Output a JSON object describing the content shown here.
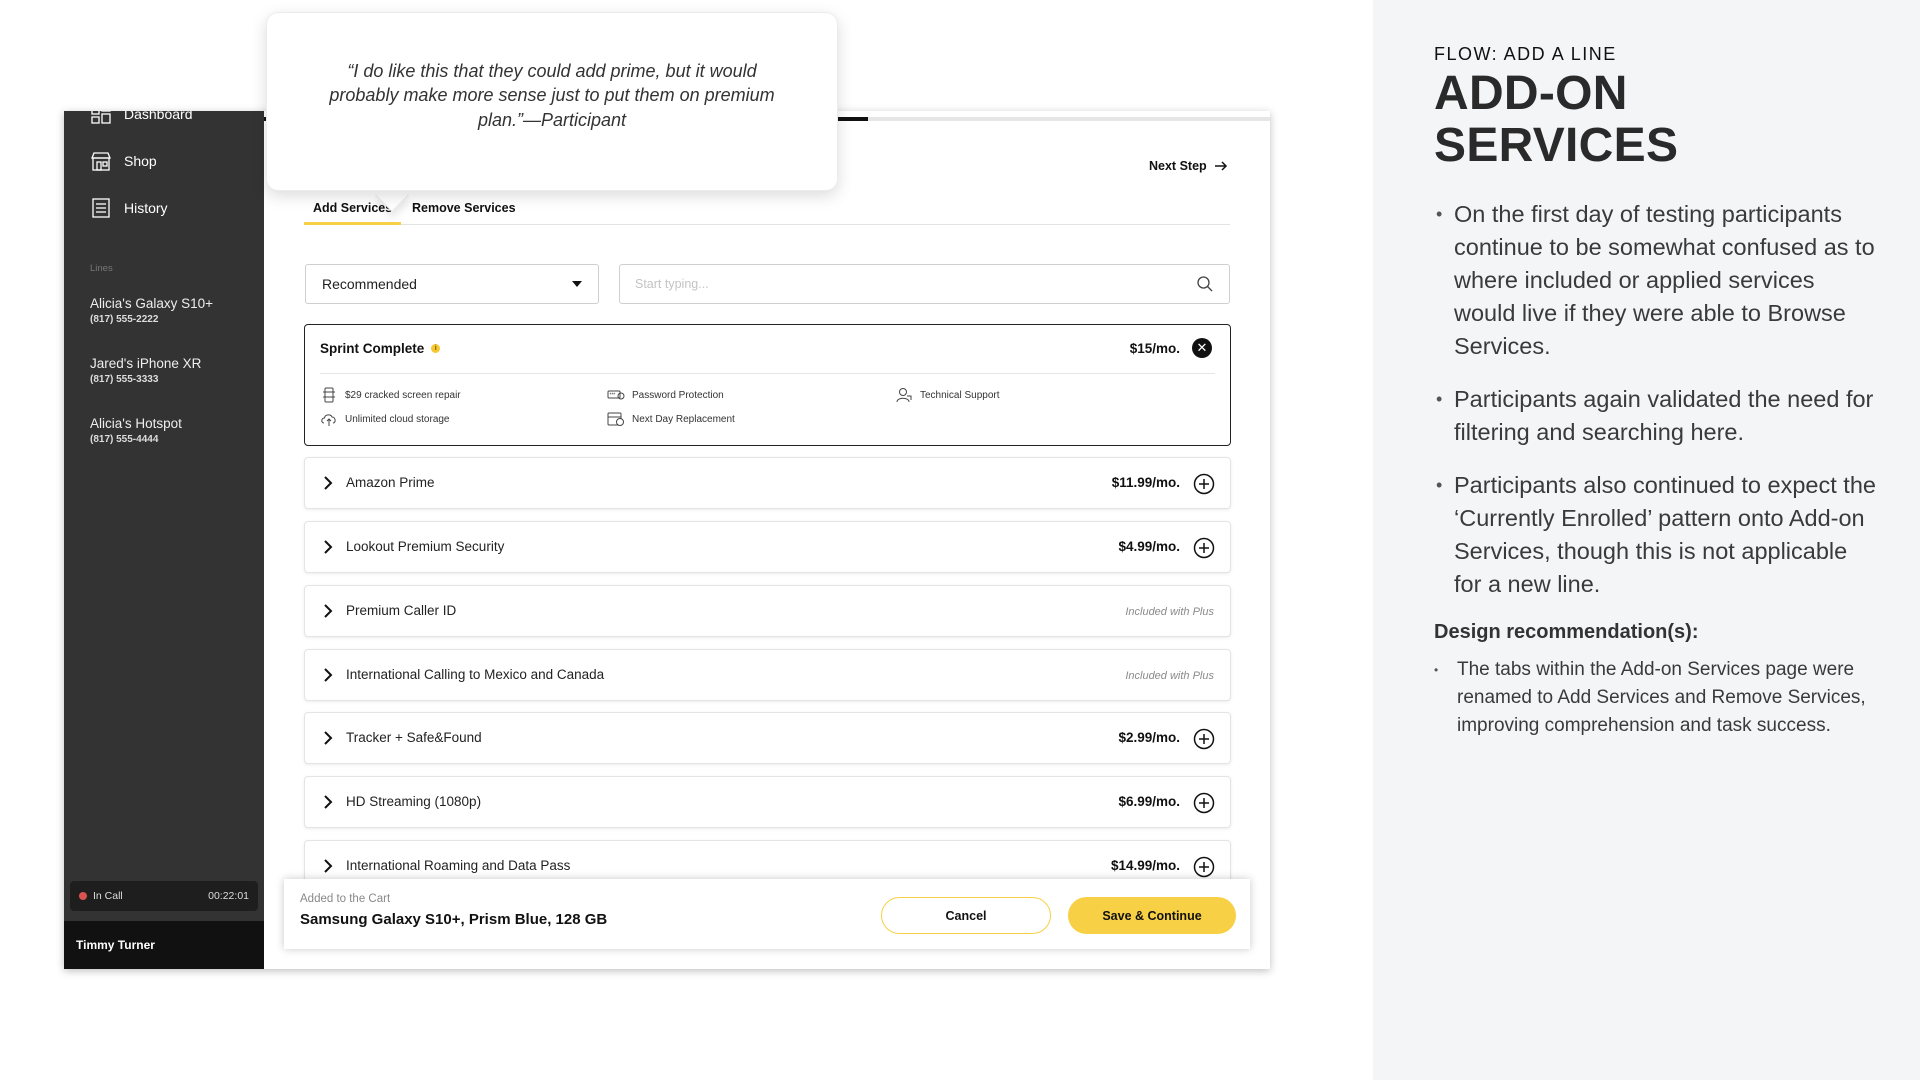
{
  "right_panel": {
    "flow_label": "FLOW: ADD A LINE",
    "heading": "ADD-ON SERVICES",
    "bullets": [
      "On the first day of testing participants continue to be somewhat confused as to where included or applied services would live if they were able to Browse Services.",
      "Participants again validated the need for filtering and searching here.",
      "Participants also continued to expect the ‘Currently Enrolled’ pattern onto Add-on Services, though this is not applicable for a new line."
    ],
    "recommendation_heading": "Design recommendation(s):",
    "recommendations": [
      "The tabs within the Add-on Services page were renamed to Add Services and Remove Services, improving comprehension and task success."
    ]
  },
  "quote": "“I do like this that they could add prime, but it would probably make more sense just to put them on premium plan.”—Participant",
  "sidebar": {
    "nav": [
      {
        "label": "Dashboard",
        "icon": "dashboard-icon"
      },
      {
        "label": "Shop",
        "icon": "shop-icon"
      },
      {
        "label": "History",
        "icon": "history-icon"
      }
    ],
    "lines_label": "Lines",
    "lines": [
      {
        "name": "Alicia's Galaxy S10+",
        "number": "(817) 555-2222"
      },
      {
        "name": "Jared's iPhone XR",
        "number": "(817) 555-3333"
      },
      {
        "name": "Alicia's Hotspot",
        "number": "(817) 555-4444"
      }
    ],
    "call_status": "In Call",
    "call_timer": "00:22:01",
    "user_name": "Timmy Turner"
  },
  "progress": {
    "fraction": 0.6
  },
  "header": {
    "next_step": "Next Step"
  },
  "tabs": [
    {
      "label": "Add Services",
      "active": true
    },
    {
      "label": "Remove Services",
      "active": false
    }
  ],
  "filter": {
    "selected": "Recommended",
    "search_placeholder": "Start typing..."
  },
  "featured": {
    "name": "Sprint Complete",
    "price": "$15/mo.",
    "features": [
      {
        "label": "$29 cracked screen repair",
        "icon": "phone-repair-icon"
      },
      {
        "label": "Password Protection",
        "icon": "password-icon"
      },
      {
        "label": "Technical Support",
        "icon": "support-icon"
      },
      {
        "label": "Unlimited cloud storage",
        "icon": "cloud-icon"
      },
      {
        "label": "Next Day Replacement",
        "icon": "calendar-icon"
      }
    ]
  },
  "services": [
    {
      "name": "Amazon Prime",
      "price": "$11.99/mo.",
      "included": ""
    },
    {
      "name": "Lookout Premium Security",
      "price": "$4.99/mo.",
      "included": ""
    },
    {
      "name": "Premium Caller ID",
      "price": "",
      "included": "Included with Plus"
    },
    {
      "name": "International Calling to Mexico and Canada",
      "price": "",
      "included": "Included with Plus"
    },
    {
      "name": "Tracker + Safe&Found",
      "price": "$2.99/mo.",
      "included": ""
    },
    {
      "name": "HD Streaming (1080p)",
      "price": "$6.99/mo.",
      "included": ""
    },
    {
      "name": "International Roaming and Data Pass",
      "price": "$14.99/mo.",
      "included": ""
    }
  ],
  "cart": {
    "label": "Added to the Cart",
    "item": "Samsung Galaxy S10+, Prism Blue, 128 GB",
    "cancel": "Cancel",
    "save": "Save & Continue"
  },
  "colors": {
    "accent": "#f7d046",
    "sidebar": "#333333",
    "panel": "#f4f5f7"
  }
}
